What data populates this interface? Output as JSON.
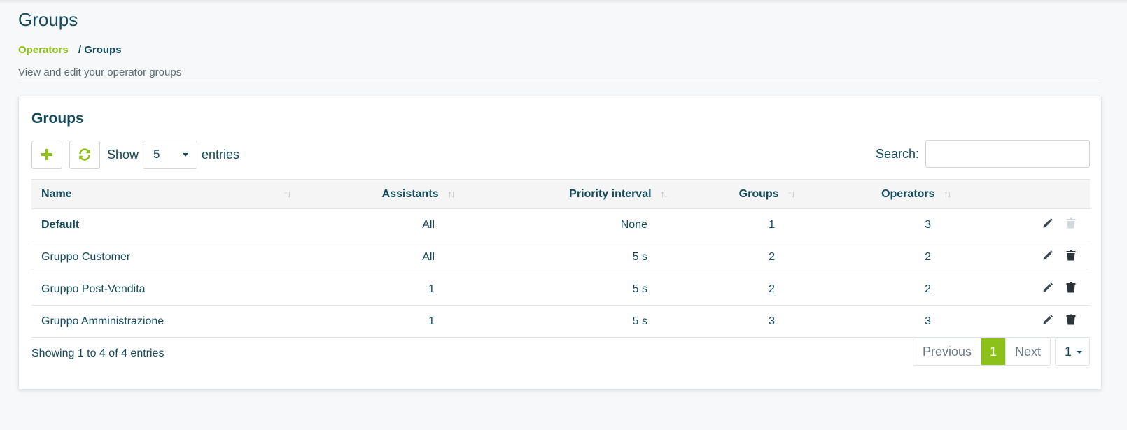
{
  "page": {
    "title": "Groups",
    "breadcrumb": {
      "parent": "Operators",
      "separator": "/",
      "current": "Groups"
    },
    "subtitle": "View and edit your operator groups"
  },
  "card": {
    "title": "Groups",
    "toolbar": {
      "show_label": "Show",
      "page_size": "5",
      "entries_label": "entries"
    },
    "search": {
      "label": "Search:",
      "value": ""
    }
  },
  "table": {
    "columns": [
      "Name",
      "Assistants",
      "Priority interval",
      "Groups",
      "Operators"
    ],
    "sort_icon": "↑↓",
    "rows": [
      {
        "name": "Default",
        "assistants": "All",
        "priority_interval": "None",
        "groups": "1",
        "operators": "3",
        "delete_enabled": false
      },
      {
        "name": "Gruppo Customer",
        "assistants": "All",
        "priority_interval": "5 s",
        "groups": "2",
        "operators": "2",
        "delete_enabled": true
      },
      {
        "name": "Gruppo Post-Vendita",
        "assistants": "1",
        "priority_interval": "5 s",
        "groups": "2",
        "operators": "2",
        "delete_enabled": true
      },
      {
        "name": "Gruppo Amministrazione",
        "assistants": "1",
        "priority_interval": "5 s",
        "groups": "3",
        "operators": "3",
        "delete_enabled": true
      }
    ]
  },
  "footer": {
    "info": "Showing 1 to 4 of 4 entries",
    "pagination": {
      "previous": "Previous",
      "current_page": "1",
      "next": "Next",
      "page_select": "1"
    }
  },
  "colors": {
    "accent": "#8cc11a",
    "text": "#134a5c",
    "disabled_icon": "#d3d8dc"
  },
  "icons": [
    "plus-icon",
    "refresh-icon",
    "pencil-icon",
    "trash-icon",
    "sort-icon",
    "caret-down-icon"
  ]
}
